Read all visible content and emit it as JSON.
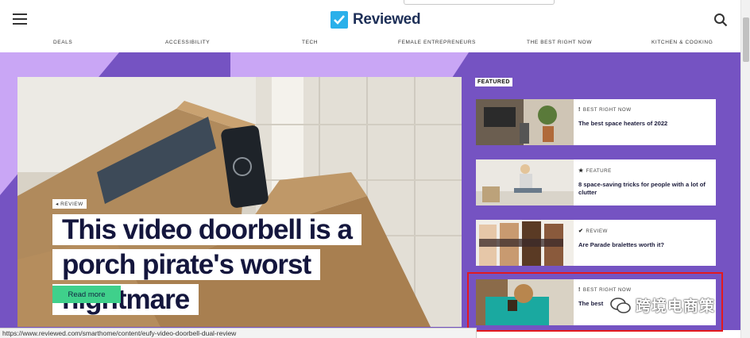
{
  "header": {
    "logo_text": "Reviewed",
    "nav": [
      "DEALS",
      "ACCESSIBILITY",
      "TECH",
      "FEMALE ENTREPRENEURS",
      "THE BEST RIGHT NOW",
      "KITCHEN & COOKING"
    ]
  },
  "hero": {
    "tag": "REVIEW",
    "title": "This video doorbell is a porch pirate's worst nightmare",
    "button": "Read more"
  },
  "featured": {
    "label": "FEATURED",
    "cards": [
      {
        "type": "BEST RIGHT NOW",
        "icon": "exclamation",
        "title": "The best space heaters of 2022"
      },
      {
        "type": "FEATURE",
        "icon": "star",
        "title": "8 space-saving tricks for people with a lot of clutter"
      },
      {
        "type": "REVIEW",
        "icon": "check",
        "title": "Are Parade bralettes worth it?"
      },
      {
        "type": "BEST RIGHT NOW",
        "icon": "exclamation",
        "title": "The best"
      }
    ]
  },
  "watermark": {
    "text": "跨境电商策"
  },
  "status_url": "https://www.reviewed.com/smarthome/content/eufy-video-doorbell-dual-review",
  "colors": {
    "band": "#7553c2",
    "accent_light": "#c9a6f5",
    "logo_blue": "#2bb0ea",
    "button_green": "#3fd08b",
    "highlight_red": "#e3191e"
  }
}
